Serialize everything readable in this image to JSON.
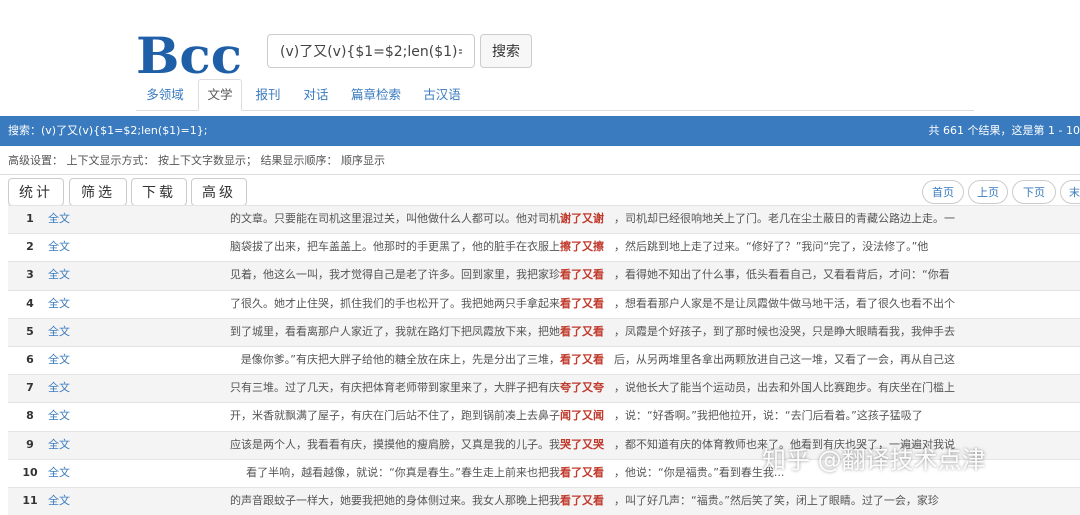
{
  "logo": {
    "text": "Bcc"
  },
  "search": {
    "value": "(v)了又(v){$1=$2;len($1)=1}",
    "button": "搜索"
  },
  "nav_tabs": [
    {
      "label": "多领域",
      "active": false
    },
    {
      "label": "文学",
      "active": true
    },
    {
      "label": "报刊",
      "active": false
    },
    {
      "label": "对话",
      "active": false
    },
    {
      "label": "篇章检索",
      "active": false
    },
    {
      "label": "古汉语",
      "active": false
    }
  ],
  "result_bar": {
    "query": "搜索：(v)了又(v){$1=$2;len($1)=1};",
    "summary": "共 661 个结果，这是第 1 - 10"
  },
  "advanced": {
    "text": "高级设置： 上下文显示方式： 按上下文字数显示； 结果显示顺序： 顺序显示"
  },
  "toolbar": {
    "stats": "统计",
    "filter": "筛选",
    "download": "下载",
    "advanced": "高级"
  },
  "pager": {
    "first": "首页",
    "prev": "上页",
    "next": "下页",
    "last": "末"
  },
  "rows": [
    {
      "num": "1",
      "link": "全文",
      "left": "的文章。只要能在司机这里混过关，叫他做什么人都可以。他对司机",
      "kw": "谢了又谢",
      "right": "，司机却已经很响地关上了门。老几在尘土蔽日的青藏公路边上走。一"
    },
    {
      "num": "2",
      "link": "全文",
      "left": "脑袋拔了出来，把车盖盖上。他那时的手更黑了，他的脏手在衣服上",
      "kw": "擦了又擦",
      "right": "，然后跳到地上走了过来。“修好了？”我问“完了，没法修了。”他"
    },
    {
      "num": "3",
      "link": "全文",
      "left": "见着，他这么一叫，我才觉得自己是老了许多。回到家里，我把家珍",
      "kw": "看了又看",
      "right": "，看得她不知出了什么事，低头看看自己，又看看背后，才问：“你看"
    },
    {
      "num": "4",
      "link": "全文",
      "left": "了很久。她才止住哭，抓住我们的手也松开了。我把她两只手拿起来",
      "kw": "看了又看",
      "right": "，想看看那户人家是不是让凤霞做牛做马地干活，看了很久也看不出个"
    },
    {
      "num": "5",
      "link": "全文",
      "left": "到了城里，看看离那户人家近了，我就在路灯下把凤霞放下来，把她",
      "kw": "看了又看",
      "right": "，凤霞是个好孩子，到了那时候也没哭，只是睁大眼睛看我，我伸手去"
    },
    {
      "num": "6",
      "link": "全文",
      "left": "是像你爹。”有庆把大胖子给他的糖全放在床上，先是分出了三堆，",
      "kw": "看了又看",
      "right": "后，从另两堆里各拿出两颗放进自己这一堆，又看了一会，再从自己这"
    },
    {
      "num": "7",
      "link": "全文",
      "left": "只有三堆。过了几天，有庆把体育老师带到家里来了，大胖子把有庆",
      "kw": "夸了又夸",
      "right": "，说他长大了能当个运动员，出去和外国人比赛跑步。有庆坐在门槛上"
    },
    {
      "num": "8",
      "link": "全文",
      "left": "开，米香就飘满了屋子，有庆在门后站不住了，跑到锅前凑上去鼻子",
      "kw": "闻了又闻",
      "right": "，说：“好香啊。”我把他拉开，说：“去门后看着。”这孩子猛吸了"
    },
    {
      "num": "9",
      "link": "全文",
      "left": "应该是两个人，我看看有庆，摸摸他的瘦肩膀，又真是我的儿子。我",
      "kw": "哭了又哭",
      "right": "，都不知道有庆的体育教师也来了。他看到有庆也哭了，一遍遍对我说"
    },
    {
      "num": "10",
      "link": "全文",
      "left": "看了半响，越看越像，就说：“你真是春生。”春生走上前来也把我",
      "kw": "看了又看",
      "right": "，他说：“你是福贵。”看到春生我..."
    },
    {
      "num": "11",
      "link": "全文",
      "left": "的声音跟蚊子一样大，她要我把她的身体侧过来。我女人那晚上把我",
      "kw": "看了又看",
      "right": "，叫了好几声：“福贵。”然后笑了笑，闭上了眼睛。过了一会，家珍"
    }
  ],
  "watermark": "知乎 @翻译技术点津"
}
